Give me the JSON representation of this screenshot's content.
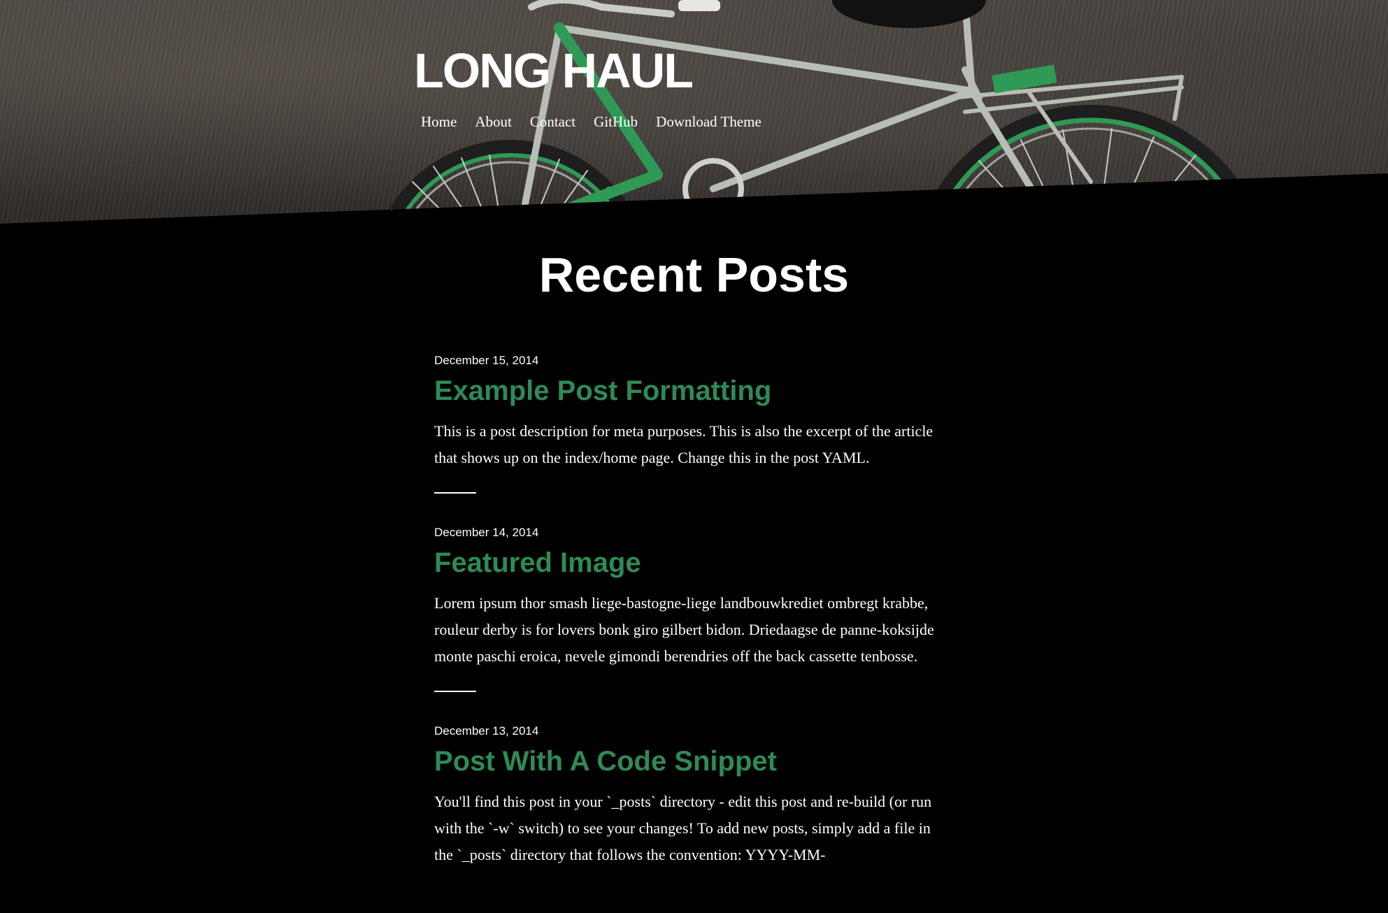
{
  "site": {
    "title": "LONG HAUL"
  },
  "nav": {
    "items": [
      {
        "label": "Home"
      },
      {
        "label": "About"
      },
      {
        "label": "Contact"
      },
      {
        "label": "GitHub"
      },
      {
        "label": "Download Theme"
      }
    ]
  },
  "main": {
    "heading": "Recent Posts",
    "posts": [
      {
        "date": "December 15, 2014",
        "title": "Example Post Formatting",
        "excerpt": "This is a post description for meta purposes. This is also the excerpt of the article that shows up on the index/home page. Change this in the post YAML."
      },
      {
        "date": "December 14, 2014",
        "title": "Featured Image",
        "excerpt": "Lorem ipsum thor smash liege-bastogne-liege landbouwkrediet ombregt krabbe, rouleur derby is for lovers bonk giro gilbert bidon. Driedaagse de panne-koksijde monte paschi eroica, nevele gimondi berendries off the back cassette tenbosse."
      },
      {
        "date": "December 13, 2014",
        "title": "Post With A Code Snippet",
        "excerpt": "You'll find this post in your `_posts` directory - edit this post and re-build (or run with the `-w` switch) to see your changes! To add new posts, simply add a file in the `_posts` directory that follows the convention: YYYY-MM-"
      }
    ]
  },
  "colors": {
    "background": "#000000",
    "accent": "#2f8a55",
    "text": "#ffffff",
    "hero_wall": "#3b3633",
    "bike_frame_green": "#2f9a55",
    "bike_metal": "#b8bdb6"
  },
  "hero_image": {
    "icon": "bicycle-photo"
  }
}
